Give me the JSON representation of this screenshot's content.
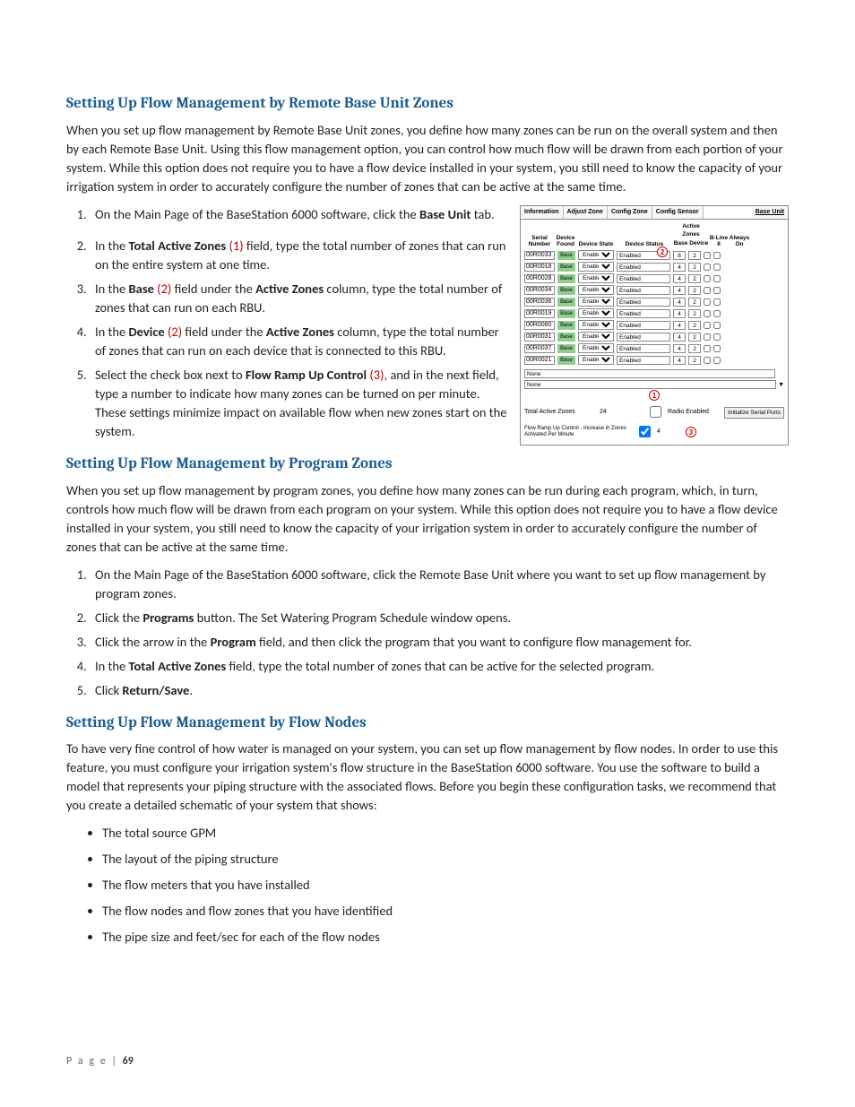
{
  "sec1": {
    "heading": "Setting Up Flow Management by Remote Base Unit Zones",
    "intro": "When you set up flow management by Remote Base Unit zones, you define how many zones can be run on the overall system and then by each Remote Base Unit. Using this flow management option, you can control how much flow will be drawn from each portion of your system. While this option does not require you to have a flow device installed in your system, you still need to know the capacity of your irrigation system in order to accurately configure the number of zones that can be active at the same time.",
    "step1_a": "On the Main Page of the BaseStation 6000 software, click the ",
    "step1_b": "Base Unit",
    "step1_c": " tab.",
    "step2_a": "In the ",
    "step2_b": "Total Active Zones",
    "step2_c": " (1)",
    "step2_d": " field, type the total number of zones that can run on the entire system at one time.",
    "step3_a": "In the ",
    "step3_b": "Base",
    "step3_c": " (2)",
    "step3_d": " field under the ",
    "step3_e": "Active Zones",
    "step3_f": " column, type the total number of zones that can run on each RBU.",
    "step4_a": "In the ",
    "step4_b": "Device",
    "step4_c": " (2)",
    "step4_d": " field under the ",
    "step4_e": "Active Zones",
    "step4_f": " column, type the total number of zones that can run on each device that is connected to this RBU.",
    "step5_a": "Select the check box next to ",
    "step5_b": "Flow Ramp Up Control",
    "step5_c": " (3)",
    "step5_d": ", and in the next field, type a number to indicate how many zones can be turned on per minute. These settings minimize impact on available flow when new zones start on the system."
  },
  "sec2": {
    "heading": "Setting Up Flow Management by Program Zones",
    "intro": "When you set up flow management by program zones, you define how many zones can be run during each program, which, in turn, controls how much flow will be drawn from each program on your system. While this option does not require you to have a flow device installed in your system, you still need to know the capacity of your irrigation system in order to accurately configure the number of zones that can be active at the same time.",
    "step1": "On the Main Page of the BaseStation 6000 software, click the Remote Base Unit where you want to set up flow management by program zones.",
    "step2_a": "Click the ",
    "step2_b": "Programs",
    "step2_c": " button. The Set Watering Program Schedule window opens.",
    "step3_a": "Click the arrow in the ",
    "step3_b": "Program",
    "step3_c": " field, and then click the program that you want to configure flow management for.",
    "step4_a": "In the ",
    "step4_b": "Total Active Zones",
    "step4_c": " field, type the total number of zones that can be active for the selected program.",
    "step5_a": "Click ",
    "step5_b": "Return/Save",
    "step5_c": "."
  },
  "sec3": {
    "heading": "Setting Up Flow Management by Flow Nodes",
    "intro": "To have very fine control of how water is managed on your system, you can set up flow management by flow nodes. In order to use this feature, you must configure your irrigation system's flow structure in the BaseStation 6000 software. You use the software to build a model that represents your piping structure with the associated flows. Before you begin these configuration tasks, we recommend that you create a detailed schematic of your system that shows:",
    "b1": "The total source GPM",
    "b2": "The layout of the piping structure",
    "b3": "The flow meters that you have installed",
    "b4": "The flow nodes and flow zones that you have identified",
    "b5": "The pipe size and feet/sec for each of the flow nodes"
  },
  "figure": {
    "tabs": [
      "Information",
      "Adjust Zone",
      "Config Zone",
      "Config Sensor",
      "Base Unit"
    ],
    "hdr": {
      "serial": "Serial\nNumber",
      "found": "Device\nFound",
      "state": "Device State",
      "status": "Device Status",
      "active": "Active Zones",
      "base": "Base",
      "device": "Device",
      "bline": "B-Line\nII",
      "always": "Always\nOn"
    },
    "rows": [
      {
        "serial": "00R0033",
        "found": "Base",
        "state": "Enabled",
        "status": "Enabled",
        "base": "8",
        "device": "2"
      },
      {
        "serial": "00R0018",
        "found": "Base",
        "state": "Enabled",
        "status": "Enabled",
        "base": "4",
        "device": "2"
      },
      {
        "serial": "00R0028",
        "found": "Base",
        "state": "Enabled",
        "status": "Enabled",
        "base": "4",
        "device": "2"
      },
      {
        "serial": "00R0034",
        "found": "Base",
        "state": "Enabled",
        "status": "Enabled",
        "base": "4",
        "device": "2"
      },
      {
        "serial": "00R0036",
        "found": "Base",
        "state": "Enabled",
        "status": "Enabled",
        "base": "4",
        "device": "2"
      },
      {
        "serial": "00R0019",
        "found": "Base",
        "state": "Enabled",
        "status": "Enabled",
        "base": "4",
        "device": "2"
      },
      {
        "serial": "00R0060",
        "found": "Base",
        "state": "Enabled",
        "status": "Enabled",
        "base": "4",
        "device": "2"
      },
      {
        "serial": "00R0031",
        "found": "Base",
        "state": "Enabled",
        "status": "Enabled",
        "base": "4",
        "device": "2"
      },
      {
        "serial": "00R0037",
        "found": "Base",
        "state": "Enabled",
        "status": "Enabled",
        "base": "4",
        "device": "2"
      },
      {
        "serial": "00R0021",
        "found": "Base",
        "state": "Enabled",
        "status": "Enabled",
        "base": "4",
        "device": "2"
      }
    ],
    "none": "None",
    "total_label": "Total Active Zones",
    "total_val": "24",
    "ramp_label": "Flow Ramp Up Control - Increase in Zones Activated Per Minute",
    "ramp_val": "4",
    "radio": "Radio Enabled",
    "init": "Initialize Serial Ports",
    "c1": "1",
    "c2": "2",
    "c3": "3"
  },
  "footer": {
    "label": "P a g e   |",
    "num": "69"
  }
}
